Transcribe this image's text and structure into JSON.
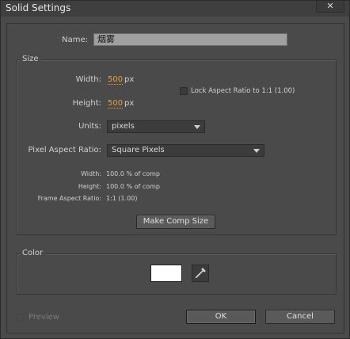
{
  "window": {
    "title": "Solid Settings",
    "close_glyph": "✕"
  },
  "name": {
    "label": "Name:",
    "value": "烟雾"
  },
  "size": {
    "group_label": "Size",
    "width_label": "Width:",
    "width_value": "500",
    "width_unit": "px",
    "height_label": "Height:",
    "height_value": "500",
    "height_unit": "px",
    "lock_label": "Lock Aspect Ratio to 1:1 (1.00)",
    "lock_checked": false,
    "units_label": "Units:",
    "units_value": "pixels",
    "par_label": "Pixel Aspect Ratio:",
    "par_value": "Square Pixels",
    "info": [
      {
        "label": "Width:",
        "value": "100.0 % of comp"
      },
      {
        "label": "Height:",
        "value": "100.0 % of comp"
      },
      {
        "label": "Frame Aspect Ratio:",
        "value": "1:1 (1.00)"
      }
    ],
    "make_comp_size_label": "Make Comp Size"
  },
  "color": {
    "group_label": "Color",
    "swatch_hex": "#ffffff",
    "eyedropper_icon": "eyedropper-icon"
  },
  "footer": {
    "preview_label": "Preview",
    "preview_checked": false,
    "ok_label": "OK",
    "cancel_label": "Cancel"
  }
}
